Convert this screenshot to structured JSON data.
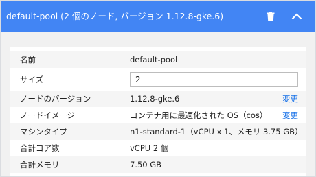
{
  "header": {
    "title": "default-pool (2 個のノード, バージョン 1.12.8-gke.6)",
    "delete_icon": "trash-icon",
    "collapse_icon": "chevron-up-icon",
    "background_color": "#4285f4"
  },
  "details": {
    "name": {
      "label": "名前",
      "value": "default-pool"
    },
    "size": {
      "label": "サイズ",
      "value": "2"
    },
    "node_version": {
      "label": "ノードのバージョン",
      "value": "1.12.8-gke.6",
      "action": "変更"
    },
    "node_image": {
      "label": "ノードイメージ",
      "value": "コンテナ用に最適化された OS（cos）",
      "action": "変更"
    },
    "machine_type": {
      "label": "マシンタイプ",
      "value": "n1-standard-1（vCPU x 1、メモリ 3.75 GB）"
    },
    "total_cores": {
      "label": "合計コア数",
      "value": "vCPU 2 個"
    },
    "total_memory": {
      "label": "合計メモリ",
      "value": "7.50 GB"
    }
  },
  "link_color": "#1a73e8"
}
